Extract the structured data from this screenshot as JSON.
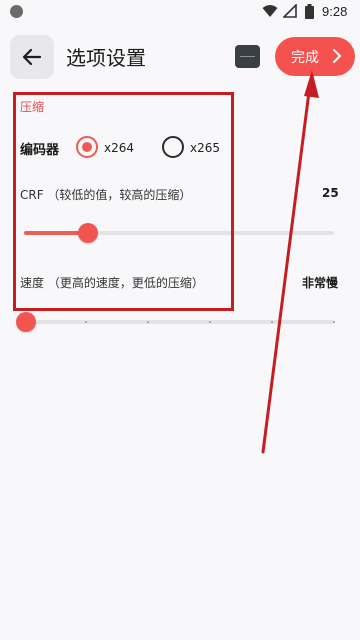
{
  "status_bar": {
    "time": "9:28"
  },
  "header": {
    "title": "选项设置",
    "done_label": "完成"
  },
  "section": {
    "title": "压缩",
    "encoder": {
      "label": "编码器",
      "options": [
        {
          "label": "x264",
          "selected": true
        },
        {
          "label": "x265",
          "selected": false
        }
      ]
    },
    "crf": {
      "label": "CRF （较低的值，较高的压缩）",
      "value_text": "25",
      "fill_fraction": 0.2
    },
    "speed": {
      "label": "速度 （更高的速度，更低的压缩）",
      "value_text": "非常慢",
      "fill_fraction": 0.0,
      "steps": 6
    }
  },
  "colors": {
    "accent": "#f4524f",
    "annotation": "#c41e23"
  }
}
